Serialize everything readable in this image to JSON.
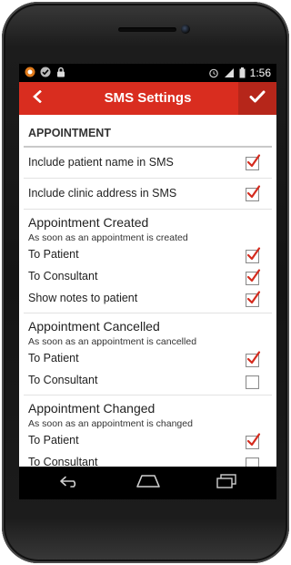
{
  "status_bar": {
    "time": "1:56",
    "icons": [
      "notification-circle-icon",
      "checkmark-badge-icon",
      "lock-icon",
      "alarm-icon",
      "signal-icon",
      "battery-icon"
    ]
  },
  "action_bar": {
    "title": "SMS Settings",
    "back_icon": "back-chevron-icon",
    "done_icon": "checkmark-icon",
    "color": "#d92d1f"
  },
  "appointment": {
    "header": "APPOINTMENT",
    "include_name": {
      "label": "Include patient name in SMS",
      "checked": true
    },
    "include_address": {
      "label": "Include clinic address in SMS",
      "checked": true
    }
  },
  "created": {
    "title": "Appointment Created",
    "subtitle": "As soon as an appointment is created",
    "to_patient": {
      "label": "To Patient",
      "checked": true
    },
    "to_consultant": {
      "label": "To Consultant",
      "checked": true
    },
    "show_notes": {
      "label": "Show notes to patient",
      "checked": true
    }
  },
  "cancelled": {
    "title": "Appointment Cancelled",
    "subtitle": "As soon as an appointment is cancelled",
    "to_patient": {
      "label": "To Patient",
      "checked": true
    },
    "to_consultant": {
      "label": "To Consultant",
      "checked": false
    }
  },
  "changed": {
    "title": "Appointment Changed",
    "subtitle": "As soon as an appointment is changed",
    "to_patient": {
      "label": "To Patient",
      "checked": true
    },
    "to_consultant": {
      "label": "To Consultant",
      "checked": false
    }
  },
  "nav_bar": {
    "buttons": [
      "back-nav-icon",
      "home-nav-icon",
      "recent-apps-icon"
    ]
  }
}
